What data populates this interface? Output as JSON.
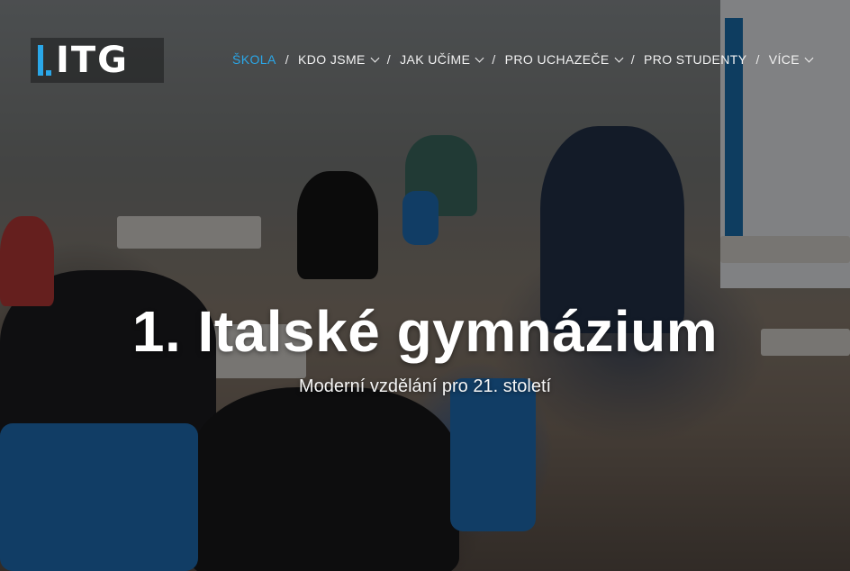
{
  "logo": {
    "text": "ITG"
  },
  "nav": {
    "items": [
      {
        "label": "ŠKOLA",
        "active": true,
        "dropdown": false
      },
      {
        "label": "KDO JSME",
        "active": false,
        "dropdown": true
      },
      {
        "label": "JAK UČÍME",
        "active": false,
        "dropdown": true
      },
      {
        "label": "PRO UCHAZEČE",
        "active": false,
        "dropdown": true
      },
      {
        "label": "PRO STUDENTY",
        "active": false,
        "dropdown": false
      },
      {
        "label": "VÍCE",
        "active": false,
        "dropdown": true
      }
    ],
    "separator": "/"
  },
  "hero": {
    "title": "1. Italské gymnázium",
    "subtitle": "Moderní vzdělání pro 21. století"
  },
  "colors": {
    "accent": "#2aa7e8",
    "overlay": "#000000"
  }
}
